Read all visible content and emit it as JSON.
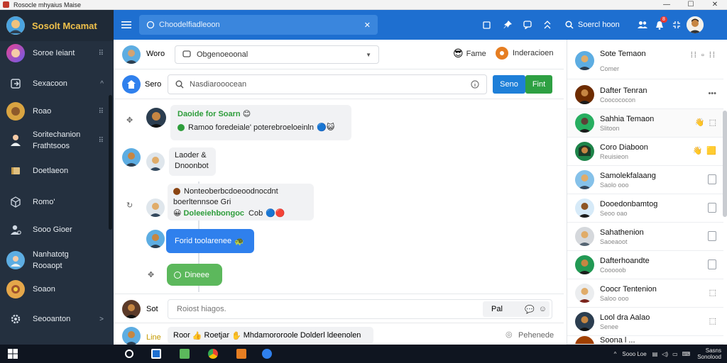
{
  "window": {
    "title": "Rosocle mhyaius Maise"
  },
  "sidebar": {
    "brand": "Sosolt Mcamat",
    "items": [
      {
        "label": "Soroe Ieiant",
        "trail": "⠿"
      },
      {
        "label": "Sexacoon",
        "trail": "^"
      },
      {
        "label": "Roao",
        "trail": "⠿"
      },
      {
        "label": "Soritechanion",
        "label2": "Frathtsoos",
        "trail": "⠿"
      },
      {
        "label": "Doetlaeon"
      },
      {
        "label": "Romo'"
      },
      {
        "label": "Sooo Gioer"
      },
      {
        "label": "Nanhatotg",
        "label2": "Rooaopt"
      },
      {
        "label": "Soaon"
      },
      {
        "label": "Seooanton",
        "trail": ">"
      }
    ]
  },
  "appbar": {
    "search_text": "Choodelfiadleoon",
    "search_label": "Soercl hoon",
    "notif_count": "8"
  },
  "chat": {
    "header": {
      "sender_label": "Woro",
      "channel_select": "Obgenoeoonal",
      "fame_label": "Fame",
      "interaction_label": "Inderacioen"
    },
    "compose_top": {
      "label": "Sero",
      "placeholder": "Nasdiarooocean",
      "send_label": "Seno",
      "post_label": "Fint"
    },
    "messages": [
      {
        "title": "Daoide for Soarn",
        "body": "Ramoo foredeiale' poterebroeloeinln"
      },
      {
        "line1": "Laoder &",
        "line2": "Dnoonbot"
      },
      {
        "line1": "Nonteoberbcdoeoodnocdnt",
        "line2a": "boerltennsoe",
        "line2b": "Gri",
        "line3a": "Doleeiehbongoc",
        "line3b": "Cob"
      },
      {
        "text": "Forid toolarenee"
      },
      {
        "text": "Dineee"
      }
    ],
    "reply": {
      "label": "Sot",
      "placeholder": "Roiost hiagos.",
      "mini_label": "Pal"
    },
    "footer": {
      "label": "Line",
      "text_a": "Roor",
      "text_b": "Roetjar",
      "text_c": "Mhdamororoole Dolderl ldeenolen",
      "status": "Pehenede"
    }
  },
  "contacts": [
    {
      "name": "Sote Temaon",
      "sub": "Comer"
    },
    {
      "name": "Dafter Tenran",
      "sub": "Coocococon"
    },
    {
      "name": "Sahhia Temaon",
      "sub": "Slitoon"
    },
    {
      "name": "Coro Diaboon",
      "sub": "Reuisieon"
    },
    {
      "name": "Samolekfalaang",
      "sub": "Saolo ooo"
    },
    {
      "name": "Dooedonbamtog",
      "sub": "Seoo oao"
    },
    {
      "name": "Sahathenion",
      "sub": "Saoeaoot"
    },
    {
      "name": "Dafterhoandte",
      "sub": "Cooooob"
    },
    {
      "name": "Coocr Tentenion",
      "sub": "Saloo ooo"
    },
    {
      "name": "Lool dra Aalao",
      "sub": "Senee"
    },
    {
      "name": "Soona l ...",
      "sub": ""
    }
  ],
  "taskbar": {
    "tray_text": "Sooo Loe",
    "clock_line1": "Sasns",
    "clock_line2": "Sonolood"
  },
  "colors": {
    "accent": "#1e6fd0",
    "sidebar": "#24303f",
    "send_button": "#1e7fd8",
    "post_button": "#2ea043",
    "green_pill": "#5cb85c",
    "blue_pill": "#2f80ed"
  }
}
